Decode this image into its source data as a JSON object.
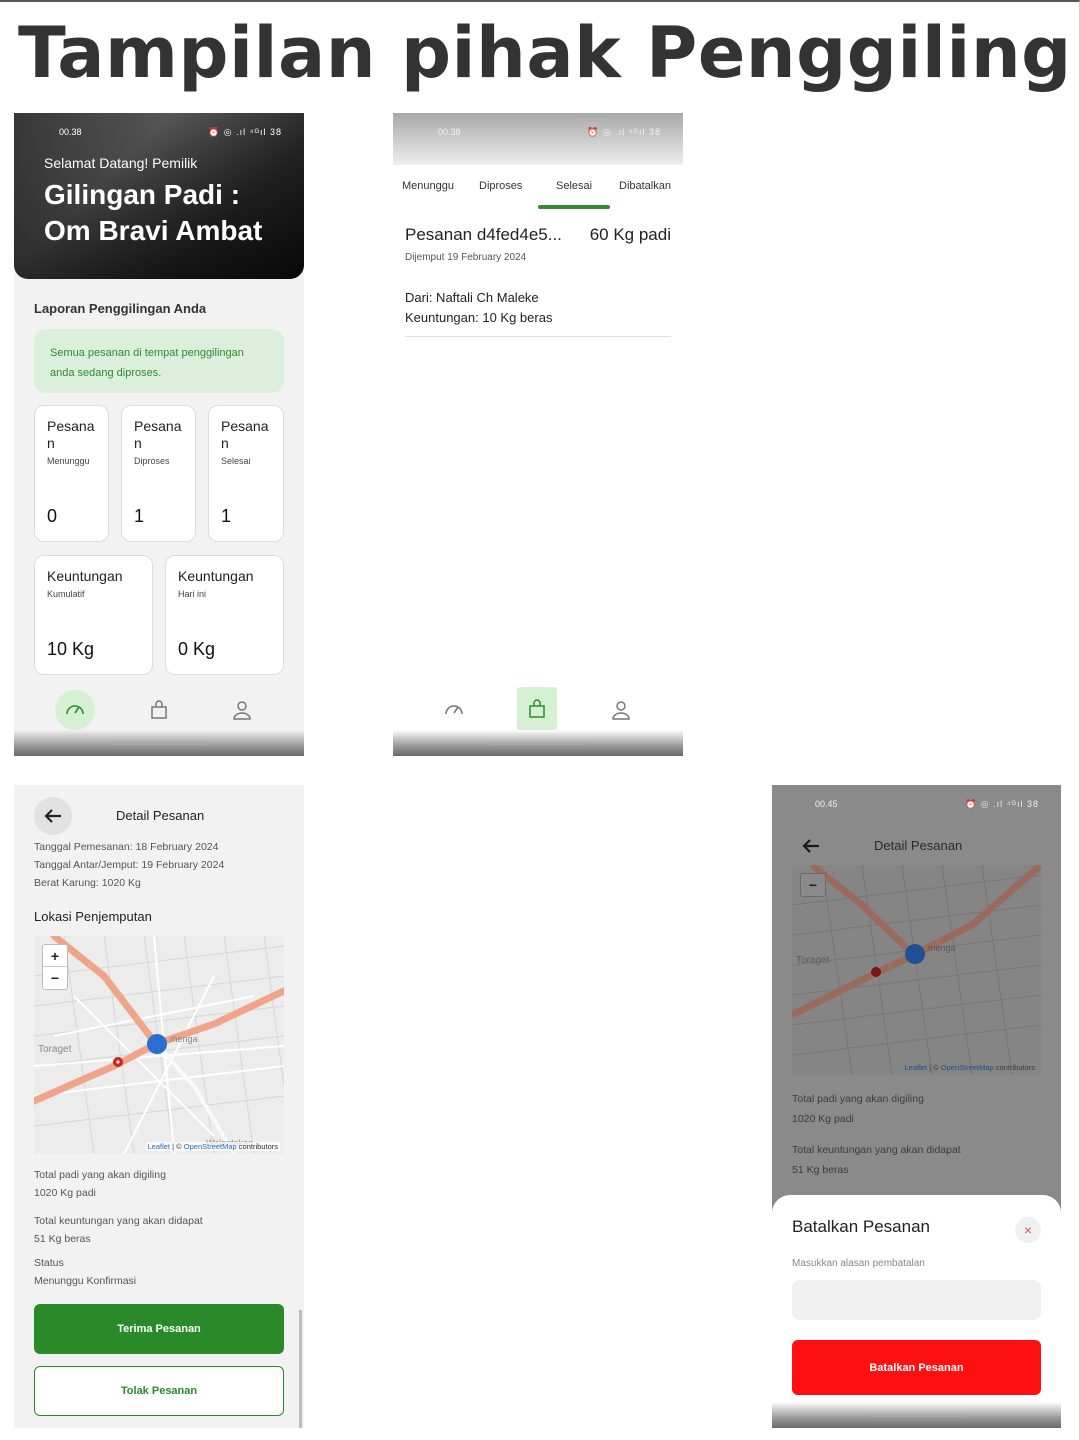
{
  "page": {
    "title": "Tampilan pihak Penggiling"
  },
  "status": {
    "time_a": "00.38",
    "time_b": "00.45",
    "icons": "⏰ ◎ .ıl ⁴ᴳıl 38"
  },
  "dashboard": {
    "greeting": "Selamat Datang! Pemilik",
    "mill_name": "Gilingan Padi : Om Bravi Ambat",
    "report_title": "Laporan Penggilingan Anda",
    "info_text": "Semua pesanan di tempat penggilingan anda sedang diproses.",
    "stats": [
      {
        "title": "Pesanan",
        "sub": "Menunggu",
        "value": "0"
      },
      {
        "title": "Pesanan",
        "sub": "Diproses",
        "value": "1"
      },
      {
        "title": "Pesanan",
        "sub": "Selesai",
        "value": "1"
      }
    ],
    "profits": [
      {
        "title": "Keuntungan",
        "sub": "Kumulatif",
        "value": "10 Kg"
      },
      {
        "title": "Keuntungan",
        "sub": "Hari ini",
        "value": "0 Kg"
      }
    ]
  },
  "orders": {
    "tabs": [
      "Menunggu",
      "Diproses",
      "Selesai",
      "Dibatalkan"
    ],
    "active_tab": "Selesai",
    "item": {
      "id": "Pesanan d4fed4e5...",
      "weight": "60 Kg padi",
      "picked": "Dijemput 19 February 2024",
      "from": "Dari: Naftali Ch Maleke",
      "profit": "Keuntungan: 10 Kg beras"
    }
  },
  "detail": {
    "header": "Detail Pesanan",
    "order_date": "Tanggal Pemesanan: 18 February 2024",
    "pickup_date": "Tanggal Antar/Jemput: 19 February 2024",
    "sack_weight": "Berat Karung: 1020 Kg",
    "location_title": "Lokasi Penjemputan",
    "map": {
      "zoom_in": "+",
      "zoom_out": "−",
      "place_a": "Toraget",
      "place_b": "menga",
      "place_c": "Walantakan",
      "attrib_leaflet": "Leaflet",
      "attrib_sep": " | © ",
      "attrib_osm": "OpenStreetMap",
      "attrib_tail": " contributors"
    },
    "total_padi_label": "Total padi yang akan digiling",
    "total_padi_value": "1020 Kg padi",
    "total_profit_label": "Total keuntungan yang akan didapat",
    "total_profit_value": "51 Kg beras",
    "status_label": "Status",
    "status_value": "Menunggu Konfirmasi",
    "accept_label": "Terima Pesanan",
    "reject_label": "Tolak Pesanan"
  },
  "cancel": {
    "title": "Batalkan Pesanan",
    "close": "×",
    "hint": "Masukkan alasan pembatalan",
    "button": "Batalkan Pesanan"
  },
  "colors": {
    "green": "#2a8a2a",
    "red": "#ff1010",
    "light_green": "#dcefdc"
  }
}
